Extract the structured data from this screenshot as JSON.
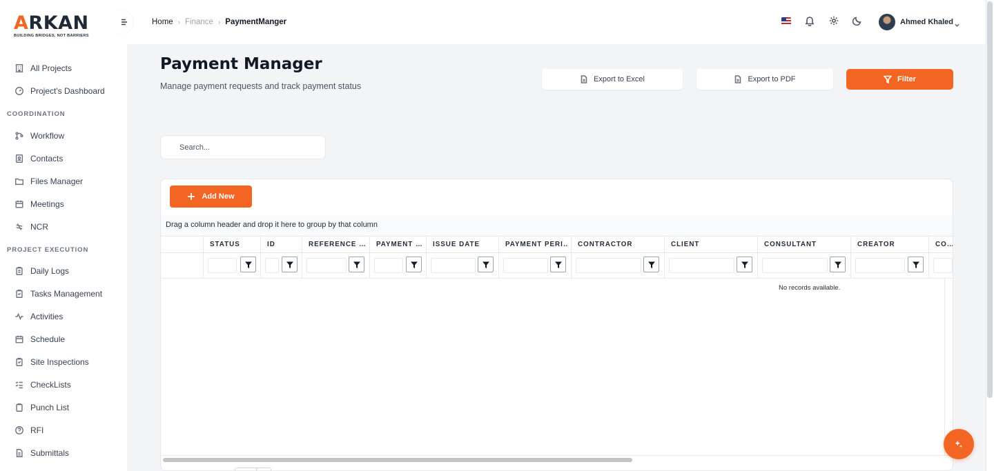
{
  "brand": {
    "logo_text": "ARKAN",
    "tagline": "BUILDING BRIDGES, NOT BARRIERS",
    "accent": "#f26522"
  },
  "sidebar": {
    "top_items": [
      {
        "label": "All Projects",
        "icon": "building-icon"
      },
      {
        "label": "Project's Dashboard",
        "icon": "gauge-icon"
      }
    ],
    "sections": [
      {
        "title": "COORDINATION",
        "items": [
          {
            "label": "Workflow",
            "icon": "workflow-icon"
          },
          {
            "label": "Contacts",
            "icon": "contacts-icon"
          },
          {
            "label": "Files Manager",
            "icon": "folder-icon"
          },
          {
            "label": "Meetings",
            "icon": "calendar-icon"
          },
          {
            "label": "NCR",
            "icon": "ncr-icon"
          }
        ]
      },
      {
        "title": "PROJECT EXECUTION",
        "items": [
          {
            "label": "Daily Logs",
            "icon": "clipboard-icon"
          },
          {
            "label": "Tasks Management",
            "icon": "tasks-icon"
          },
          {
            "label": "Activities",
            "icon": "activity-icon"
          },
          {
            "label": "Schedule",
            "icon": "schedule-icon"
          },
          {
            "label": "Site Inspections",
            "icon": "inspection-icon"
          },
          {
            "label": "CheckLists",
            "icon": "checklist-icon"
          },
          {
            "label": "Punch List",
            "icon": "punch-list-icon"
          },
          {
            "label": "RFI",
            "icon": "question-icon"
          },
          {
            "label": "Submittals",
            "icon": "submittals-icon"
          }
        ]
      }
    ]
  },
  "breadcrumb": {
    "home": "Home",
    "parent": "Finance",
    "current": "PaymentManger"
  },
  "user": {
    "name": "Ahmed Khaled"
  },
  "header": {
    "title": "Payment Manager",
    "subtitle": "Manage payment requests and track payment status",
    "export_excel": "Export to Excel",
    "export_pdf": "Export to PDF",
    "filter": "Filter"
  },
  "search": {
    "placeholder": "Search..."
  },
  "grid": {
    "add_new": "Add New",
    "group_hint": "Drag a column header and drop it here to group by that column",
    "columns": [
      "STATUS",
      "ID",
      "REFERENCE …",
      "PAYMENT …",
      "ISSUE DATE",
      "PAYMENT PERI…",
      "CONTRACTOR",
      "CLIENT",
      "CONSULTANT",
      "CREATOR",
      "CO…"
    ],
    "empty_message": "No records available."
  }
}
